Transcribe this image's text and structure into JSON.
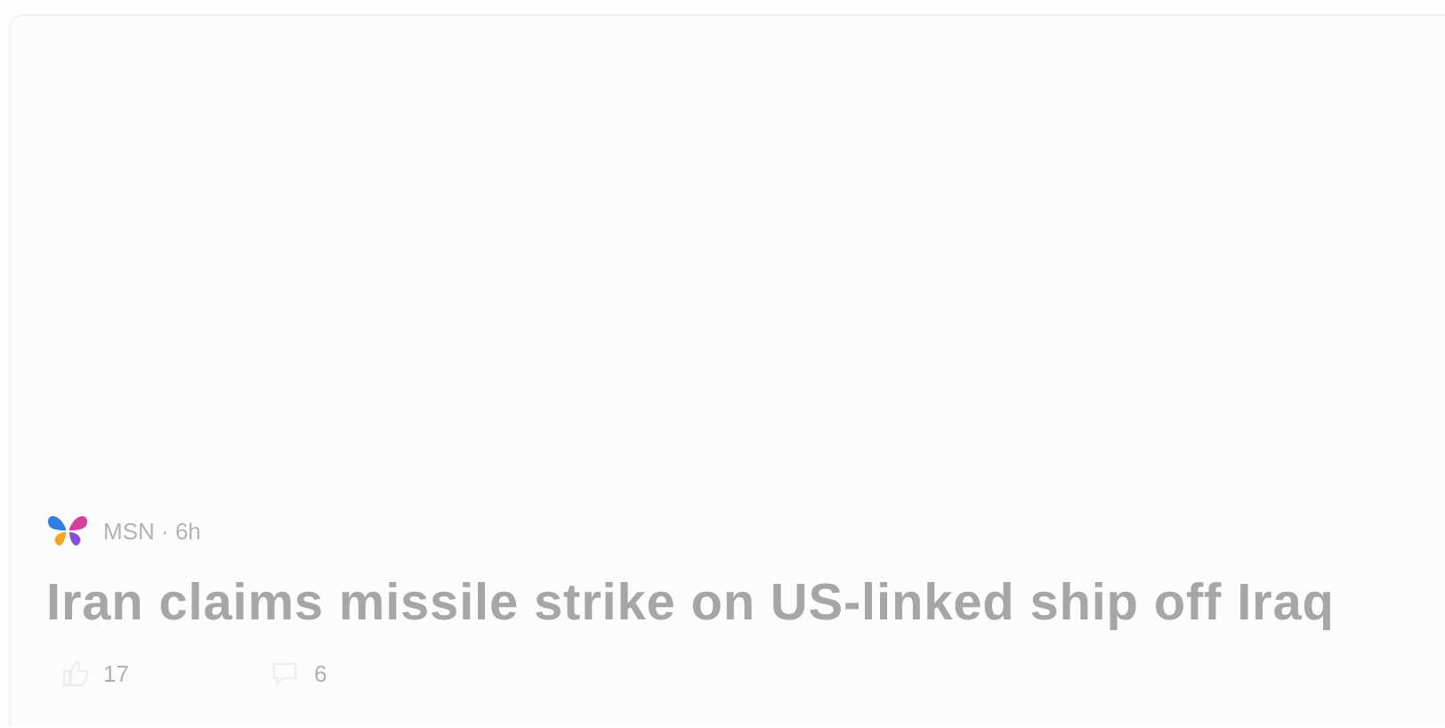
{
  "card": {
    "source": "MSN",
    "separator": "·",
    "age": "6h",
    "title": "Iran claims missile strike on US-linked ship off Iraq",
    "reactions": [
      {
        "kind": "like",
        "count": "17"
      },
      {
        "kind": "comment",
        "count": "6"
      }
    ]
  }
}
